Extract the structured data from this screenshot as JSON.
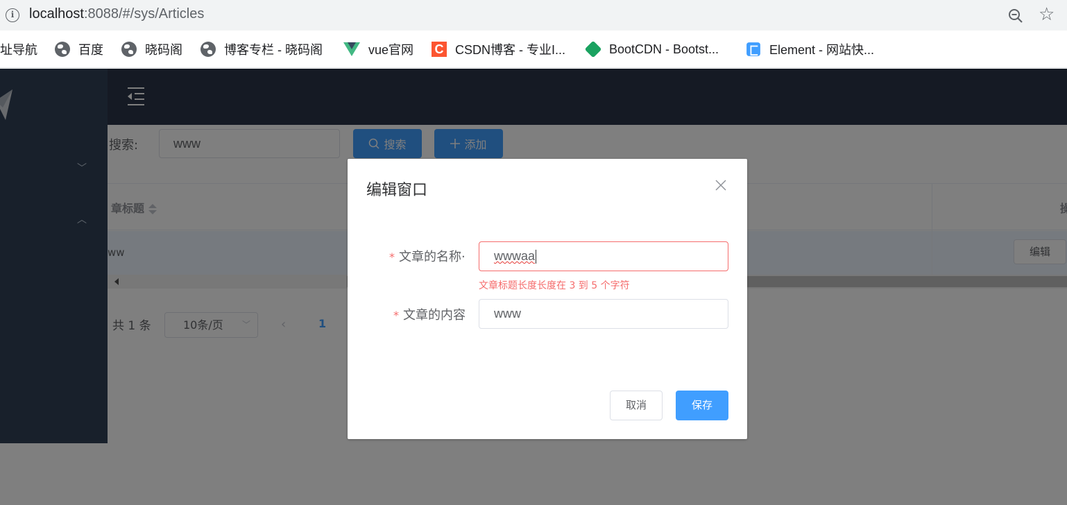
{
  "browser": {
    "url_host": "localhost",
    "url_rest": ":8088/#/sys/Articles",
    "bookmarks": [
      {
        "label": "址导航",
        "icon": "none"
      },
      {
        "label": "百度",
        "icon": "globe-icon"
      },
      {
        "label": "晓码阁",
        "icon": "globe-icon"
      },
      {
        "label": "博客专栏 - 晓码阁",
        "icon": "globe-icon"
      },
      {
        "label": "vue官网",
        "icon": "vue-icon"
      },
      {
        "label": "CSDN博客 - 专业I...",
        "icon": "csdn-icon"
      },
      {
        "label": "BootCDN - Bootst...",
        "icon": "bootcdn-icon"
      },
      {
        "label": "Element - 网站快...",
        "icon": "element-icon"
      }
    ]
  },
  "search": {
    "label": "搜索:",
    "value": "www",
    "search_button": "搜索",
    "add_button": "添加"
  },
  "table": {
    "columns": [
      "章标题",
      "操"
    ],
    "rows": [
      {
        "title": "ww",
        "edit_label": "编辑"
      }
    ]
  },
  "pager": {
    "total": "共 1 条",
    "page_size": "10条/页",
    "current_page": "1"
  },
  "dialog": {
    "title": "编辑窗口",
    "name_label": "文章的名称·",
    "name_value": "wwwaa",
    "name_error": "文章标题长度长度在 3 到 5 个字符",
    "content_label": "文章的内容",
    "content_value": "www",
    "cancel_label": "取消",
    "save_label": "保存",
    "required_mark": "*"
  },
  "colors": {
    "primary": "#409eff",
    "danger": "#f56c6c",
    "sidebar": "#304156"
  }
}
